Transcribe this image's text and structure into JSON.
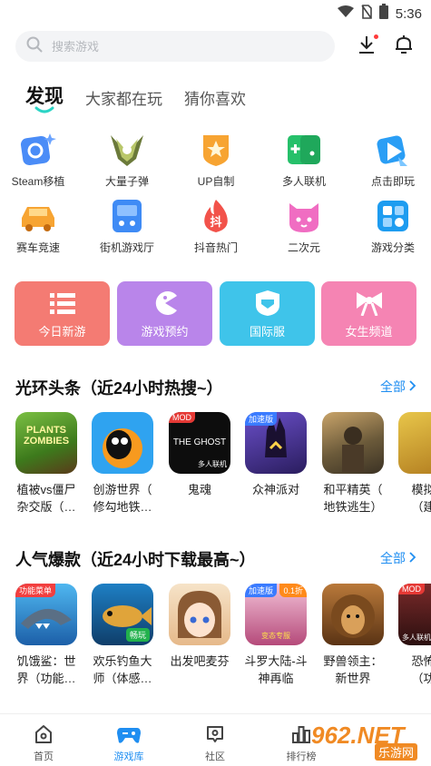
{
  "status_bar": {
    "time": "5:36"
  },
  "search": {
    "placeholder": "搜索游戏"
  },
  "tabs": [
    {
      "label": "发现",
      "active": true
    },
    {
      "label": "大家都在玩",
      "active": false
    },
    {
      "label": "猜你喜欢",
      "active": false
    }
  ],
  "grid": [
    {
      "label": "Steam移植",
      "icon": "steam-port-icon"
    },
    {
      "label": "大量子弹",
      "icon": "bullets-icon"
    },
    {
      "label": "UP自制",
      "icon": "up-made-icon"
    },
    {
      "label": "多人联机",
      "icon": "multiplayer-icon"
    },
    {
      "label": "点击即玩",
      "icon": "click-play-icon"
    },
    {
      "label": "赛车竞速",
      "icon": "racing-car-icon"
    },
    {
      "label": "街机游戏厅",
      "icon": "arcade-icon"
    },
    {
      "label": "抖音热门",
      "icon": "douyin-hot-icon"
    },
    {
      "label": "二次元",
      "icon": "anime-icon"
    },
    {
      "label": "游戏分类",
      "icon": "category-icon"
    }
  ],
  "cards": [
    {
      "label": "今日新游",
      "color": "#f47b73",
      "icon": "list-icon"
    },
    {
      "label": "游戏预约",
      "color": "#b985ea",
      "icon": "pacman-icon"
    },
    {
      "label": "国际服",
      "color": "#3fc4ea",
      "icon": "helmet-icon"
    },
    {
      "label": "女生频道",
      "color": "#f584b3",
      "icon": "bow-icon"
    }
  ],
  "section1": {
    "title": "光环头条（近24小时热搜~）",
    "see_all": "全部",
    "games": [
      {
        "name1": "植被vs僵尸",
        "name2": "杂交版（…",
        "thumb_label": "PLANTS ZOMBIES"
      },
      {
        "name1": "创游世界（",
        "name2": "修勾地铁…",
        "thumb_label": ""
      },
      {
        "name1": "鬼魂",
        "name2": "",
        "thumb_label": "THE GHOST",
        "badge": "MOD",
        "sub": "多人联机"
      },
      {
        "name1": "众神派对",
        "name2": "",
        "thumb_label": "",
        "badge": "加速版"
      },
      {
        "name1": "和平精英（",
        "name2": "地铁逃生）",
        "thumb_label": ""
      },
      {
        "name1": "模拟建",
        "name2": "（建筑",
        "thumb_label": ""
      }
    ]
  },
  "section2": {
    "title": "人气爆款（近24小时下载最高~）",
    "see_all": "全部",
    "games": [
      {
        "name1": "饥饿鲨：世",
        "name2": "界（功能…",
        "badge": "功能菜单"
      },
      {
        "name1": "欢乐钓鱼大",
        "name2": "师（体感…",
        "sub": "畅玩"
      },
      {
        "name1": "出发吧麦芬",
        "name2": ""
      },
      {
        "name1": "斗罗大陆-斗",
        "name2": "神再临",
        "badge": "加速版",
        "badge_right": "0.1折",
        "sub": "变态专服"
      },
      {
        "name1": "野兽领主：",
        "name2": "新世界"
      },
      {
        "name1": "恐怖奶",
        "name2": "（功能",
        "badge": "MOD",
        "sub": "多人联机"
      }
    ]
  },
  "bottom_nav": [
    {
      "label": "首页",
      "icon": "home-icon",
      "active": false
    },
    {
      "label": "游戏库",
      "icon": "game-library-icon",
      "active": true
    },
    {
      "label": "社区",
      "icon": "community-icon",
      "active": false
    },
    {
      "label": "排行榜",
      "icon": "ranking-icon",
      "active": false
    }
  ],
  "watermark": {
    "text": "962.NET",
    "sub": "乐游网"
  }
}
